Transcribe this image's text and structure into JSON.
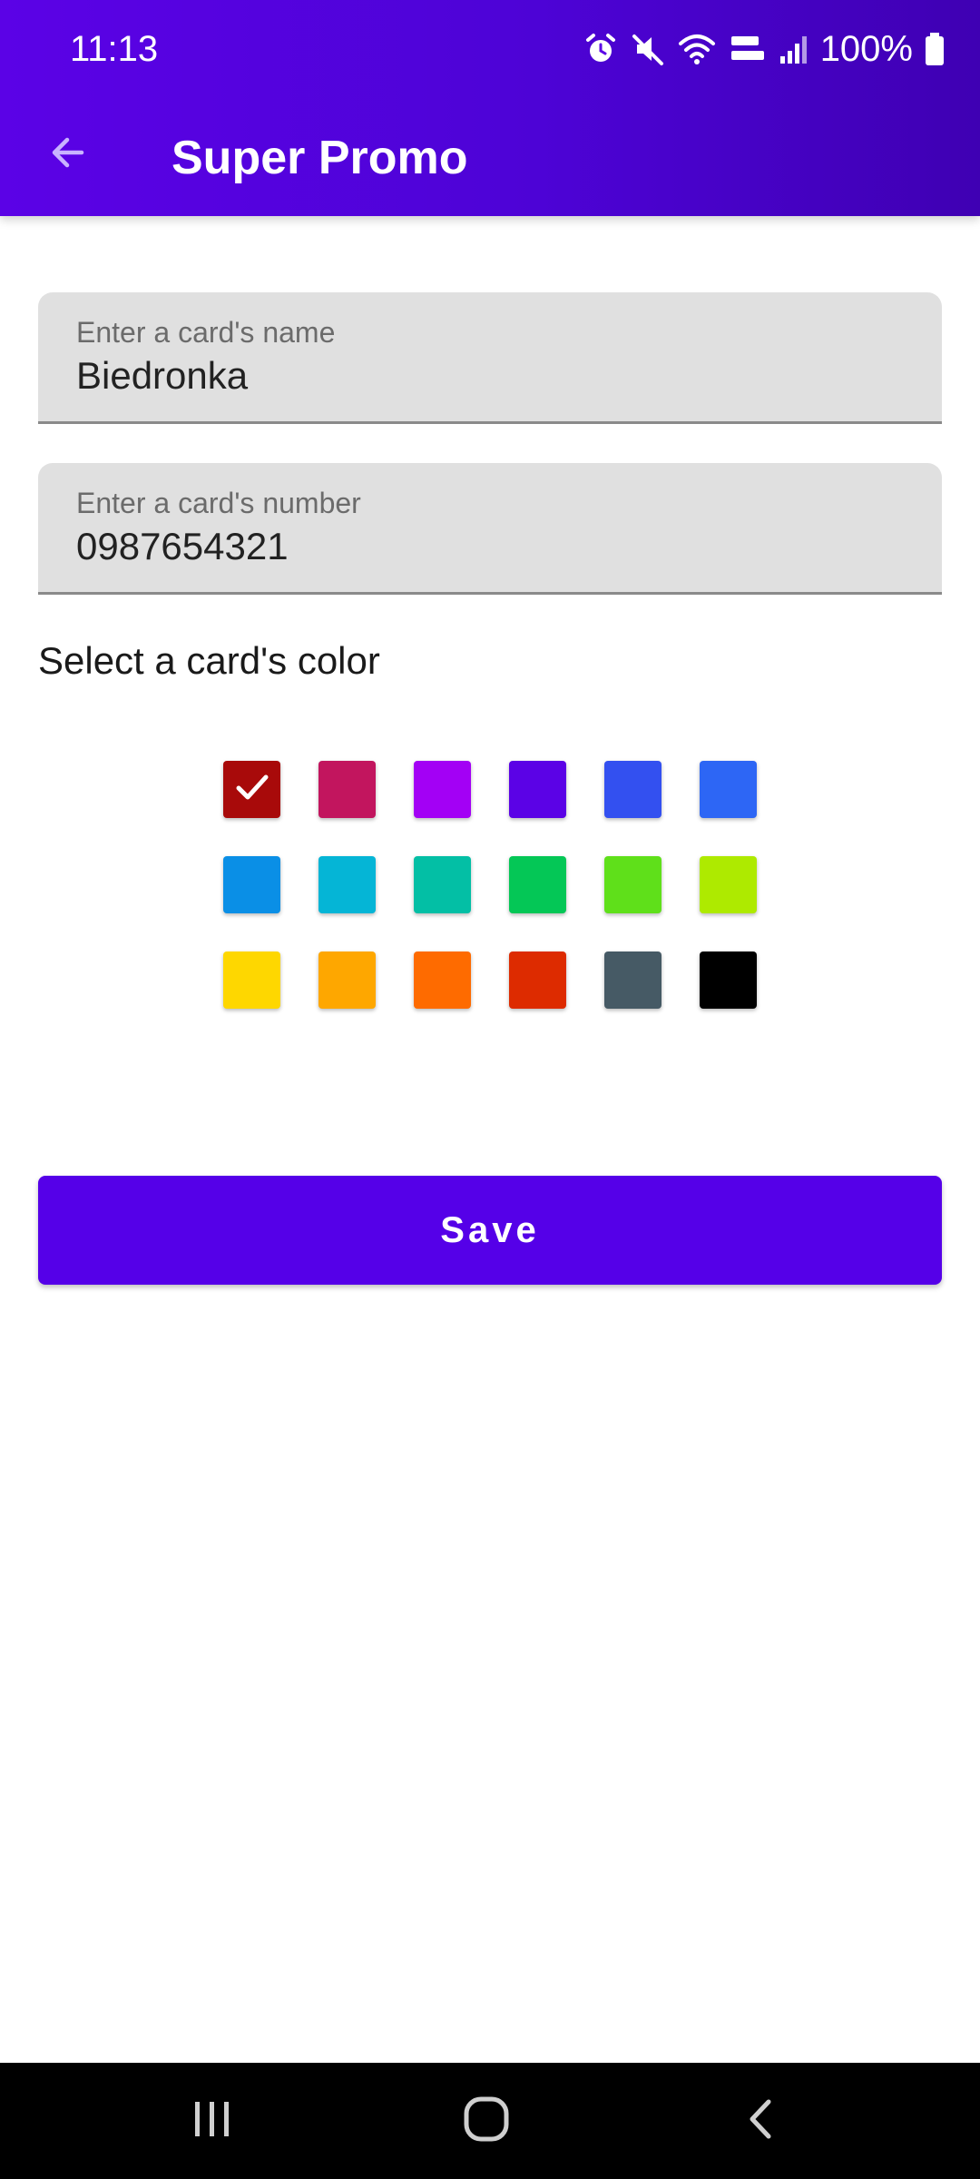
{
  "status_bar": {
    "time": "11:13",
    "battery": "100%",
    "icons": [
      "alarm-icon",
      "mute-icon",
      "wifi-icon",
      "volte-icon",
      "signal-icon",
      "battery-icon"
    ]
  },
  "toolbar": {
    "title": "Super Promo",
    "back_icon": "arrow-back-icon"
  },
  "form": {
    "name_field": {
      "label": "Enter a card's name",
      "value": "Biedronka"
    },
    "number_field": {
      "label": "Enter a card's number",
      "value": "0987654321"
    },
    "color_section_title": "Select a card's color",
    "colors": [
      "#a80a0a",
      "#c2155e",
      "#a300f5",
      "#5b02e6",
      "#3350f0",
      "#2d66f5",
      "#0a8fe6",
      "#05b5d6",
      "#03bfa5",
      "#04c756",
      "#5fe01a",
      "#aeea00",
      "#fed700",
      "#fea700",
      "#fe6b00",
      "#dd2b00",
      "#465a65",
      "#000000"
    ],
    "selected_color_index": 0,
    "save_label": "Save"
  },
  "theme": {
    "primary": "#5500e8",
    "header_gradient": [
      "#5b02e6",
      "#3f00b3"
    ]
  },
  "nav_bar": {
    "buttons": [
      "recent-apps-icon",
      "home-icon",
      "nav-back-icon"
    ]
  }
}
